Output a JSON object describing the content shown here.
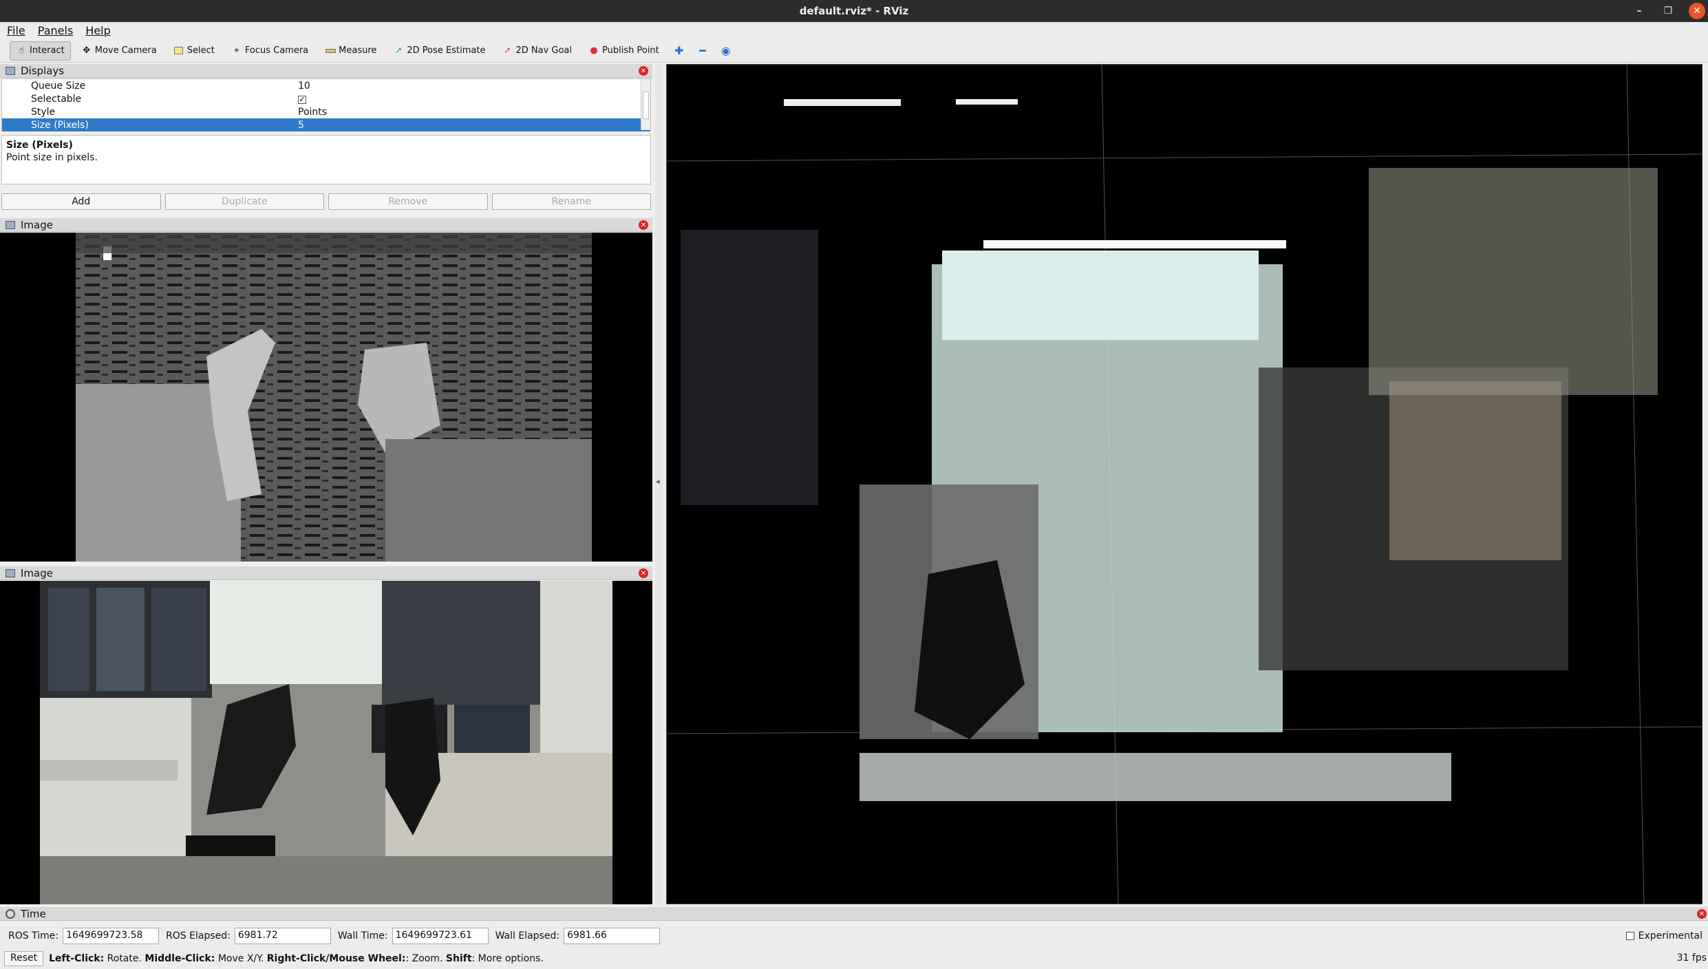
{
  "window": {
    "title": "default.rviz* - RViz"
  },
  "menu": {
    "file": "File",
    "panels": "Panels",
    "help": "Help"
  },
  "toolbar": {
    "interact": "Interact",
    "move_camera": "Move Camera",
    "select": "Select",
    "focus_camera": "Focus Camera",
    "measure": "Measure",
    "pose_estimate": "2D Pose Estimate",
    "nav_goal": "2D Nav Goal",
    "publish_point": "Publish Point"
  },
  "displays": {
    "title": "Displays",
    "rows": [
      {
        "key": "Queue Size",
        "value": "10"
      },
      {
        "key": "Selectable",
        "value": "✓"
      },
      {
        "key": "Style",
        "value": "Points"
      },
      {
        "key": "Size (Pixels)",
        "value": "5"
      }
    ],
    "description_title": "Size (Pixels)",
    "description_text": "Point size in pixels.",
    "buttons": {
      "add": "Add",
      "duplicate": "Duplicate",
      "remove": "Remove",
      "rename": "Rename"
    }
  },
  "image_panel_1": {
    "title": "Image"
  },
  "image_panel_2": {
    "title": "Image"
  },
  "time": {
    "title": "Time",
    "ros_time_label": "ROS Time:",
    "ros_time": "1649699723.58",
    "ros_elapsed_label": "ROS Elapsed:",
    "ros_elapsed": "6981.72",
    "wall_time_label": "Wall Time:",
    "wall_time": "1649699723.61",
    "wall_elapsed_label": "Wall Elapsed:",
    "wall_elapsed": "6981.66",
    "experimental": "Experimental"
  },
  "status": {
    "reset": "Reset",
    "left_click": "Left-Click:",
    "left_click_desc": "Rotate.",
    "middle_click": "Middle-Click:",
    "middle_click_desc": "Move X/Y.",
    "right_click": "Right-Click/Mouse Wheel:",
    "right_click_desc": ": Zoom.",
    "shift": "Shift",
    "shift_desc": ": More options.",
    "fps": "31 fps"
  },
  "colors": {
    "selection": "#2f7bc8",
    "close": "#e9542b",
    "titlebar": "#2c2c2c"
  }
}
